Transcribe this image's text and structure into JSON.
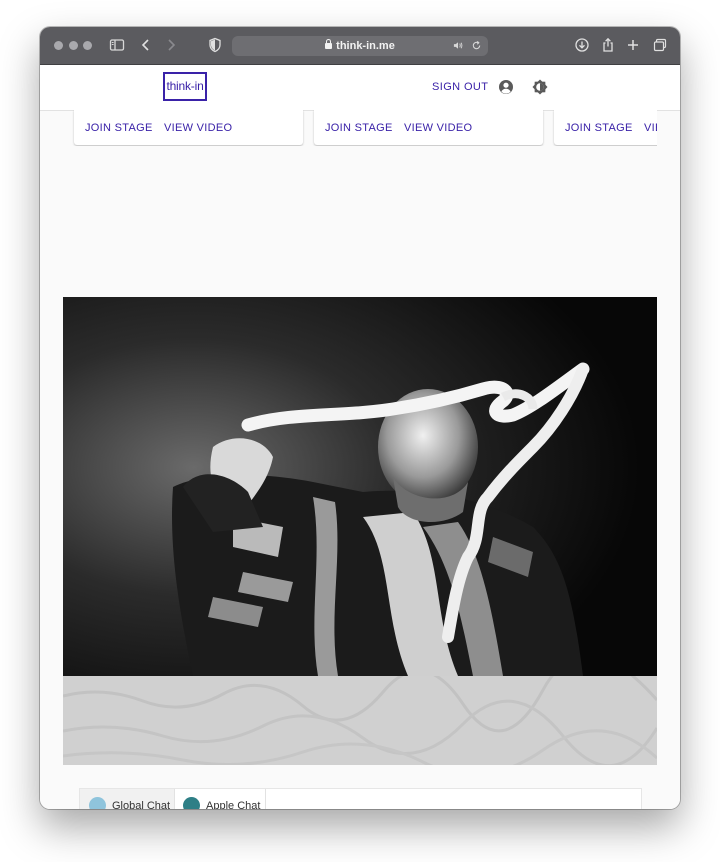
{
  "browser": {
    "url": "think-in.me",
    "icons": [
      "sidebar-icon",
      "back-icon",
      "forward-icon",
      "privacy-shield-icon",
      "lock-icon",
      "audio-icon",
      "reload-icon",
      "download-icon",
      "share-icon",
      "new-tab-icon",
      "tab-overview-icon"
    ]
  },
  "header": {
    "logo_text": "think-in",
    "sign_out": "SIGN OUT",
    "icons": [
      "account-icon",
      "theme-toggle-icon"
    ]
  },
  "cards": [
    {
      "join": "JOIN STAGE",
      "view": "VIEW VIDEO"
    },
    {
      "join": "JOIN STAGE",
      "view": "VIEW VIDEO"
    },
    {
      "join": "JOIN STAGE",
      "view": "VIEW VIDEO"
    }
  ],
  "chat": {
    "tabs": [
      {
        "label": "Global Chat",
        "avatar_color": "#8fc4dc",
        "online": true
      },
      {
        "label": "Apple Chat",
        "avatar_color": "#2e7f86",
        "online": true
      }
    ]
  },
  "colors": {
    "accent": "#3a22a8",
    "toolbar": "#5b5b5f",
    "online": "#43b34a"
  }
}
